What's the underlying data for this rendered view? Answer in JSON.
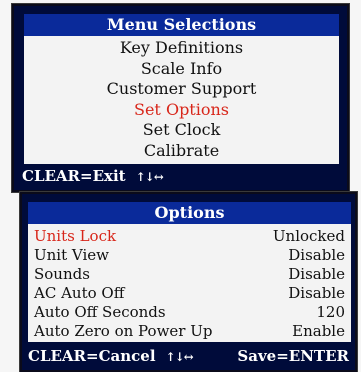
{
  "menu": {
    "title": "Menu Selections",
    "items": [
      "Key Definitions",
      "Scale Info",
      "Customer Support",
      "Set Options",
      "Set Clock",
      "Calibrate"
    ],
    "selected_index": 3,
    "footer_left": "CLEAR=Exit",
    "footer_arrows": "↑↓↔"
  },
  "options": {
    "title": "Options",
    "rows": [
      {
        "label": "Units Lock",
        "value": "Unlocked"
      },
      {
        "label": "Unit View",
        "value": "Disable"
      },
      {
        "label": "Sounds",
        "value": "Disable"
      },
      {
        "label": "AC Auto Off",
        "value": "Disable"
      },
      {
        "label": "Auto Off Seconds",
        "value": "120"
      },
      {
        "label": "Auto Zero on Power Up",
        "value": "Enable"
      }
    ],
    "selected_index": 0,
    "footer_left": "CLEAR=Cancel",
    "footer_arrows": "↑↓↔",
    "footer_right": "Save=ENTER"
  },
  "colors": {
    "title_bar": "#0a2a9a",
    "panel": "#f3f3f3",
    "selected_text": "#d8261a",
    "footer_bg": "#000b3a"
  }
}
